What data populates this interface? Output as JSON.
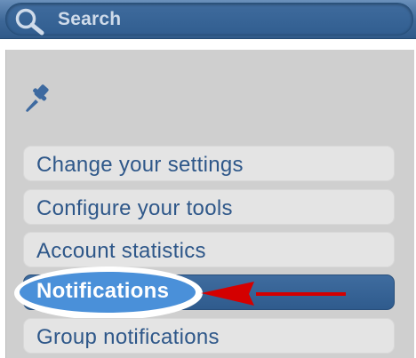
{
  "search": {
    "label": "Search"
  },
  "menu": {
    "items": [
      {
        "label": "Change your settings",
        "active": false
      },
      {
        "label": "Configure your tools",
        "active": false
      },
      {
        "label": "Account statistics",
        "active": false
      },
      {
        "label": "Notifications",
        "active": true
      },
      {
        "label": "Group notifications",
        "active": false
      }
    ]
  },
  "icons": {
    "search": "search-icon",
    "pin": "pin-icon",
    "arrow": "red-arrow-icon"
  },
  "colors": {
    "topbar": "#3d6797",
    "panel": "#cfcfcf",
    "item_text": "#2e5789",
    "active_item": "#2f5b8d",
    "highlight": "#4a90d9",
    "arrow": "#d40000"
  }
}
